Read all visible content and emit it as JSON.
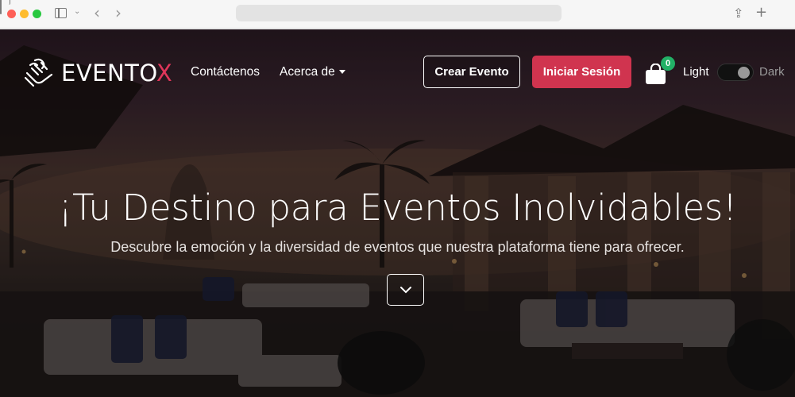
{
  "browser": {
    "url": ""
  },
  "navbar": {
    "brand_main": "EVENTO",
    "brand_accent": "X",
    "links": {
      "contact": "Contáctenos",
      "about": "Acerca de"
    },
    "create_event": "Crear Evento",
    "login": "Iniciar Sesión",
    "cart_count": "0",
    "theme": {
      "light": "Light",
      "dark": "Dark",
      "selected": "dark"
    }
  },
  "hero": {
    "title": "¡Tu Destino para Eventos Inolvidables!",
    "subtitle": "Descubre la emoción y la diversidad de eventos que nuestra plataforma tiene para ofrecer."
  },
  "colors": {
    "accent": "#d0344f",
    "brand_x": "#e0365a",
    "badge": "#22b066"
  },
  "icons": {
    "logo": "hand-flower-logo",
    "cart": "shopping-bag-icon",
    "scroll": "chevron-down-icon"
  }
}
